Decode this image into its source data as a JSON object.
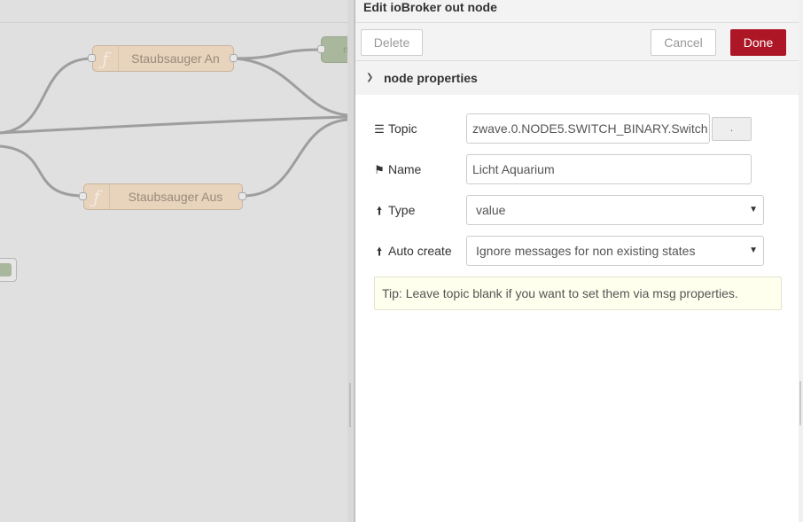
{
  "canvas": {
    "nodes": [
      {
        "label": "Staubsauger An",
        "icon": "function-icon"
      },
      {
        "label": "Staubsauger Aus",
        "icon": "function-icon"
      }
    ],
    "partial_node_label": "m"
  },
  "tray": {
    "title": "Edit ioBroker out node",
    "buttons": {
      "delete": "Delete",
      "cancel": "Cancel",
      "done": "Done"
    },
    "section": {
      "title": "node properties",
      "chevron": "chevron-down-icon"
    },
    "fields": {
      "topic": {
        "label": "Topic",
        "icon": "list-icon",
        "value": "zwave.0.NODE5.SWITCH_BINARY.Switch",
        "browse_label": "."
      },
      "name": {
        "label": "Name",
        "icon": "tag-icon",
        "value": "Licht Aquarium"
      },
      "type": {
        "label": "Type",
        "icon": "arrow-up-icon",
        "value": "value"
      },
      "auto_create": {
        "label": "Auto create",
        "icon": "arrow-up-icon",
        "value": "Ignore messages for non existing states"
      }
    },
    "tip": "Tip: Leave topic blank if you want to set them via msg properties."
  },
  "colors": {
    "done_button": "#ad1625",
    "node_fill": "#e8d3bd",
    "tip_background": "#ffffee"
  }
}
